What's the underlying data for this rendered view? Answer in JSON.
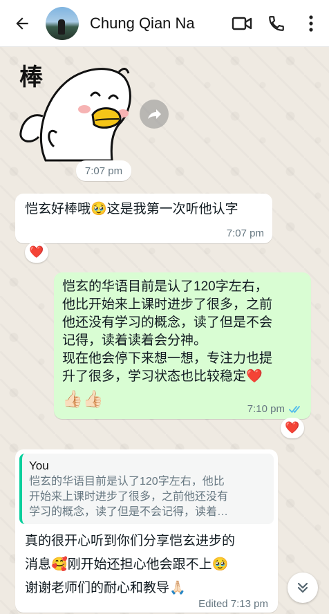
{
  "header": {
    "contact_name": "Chung Qian Na",
    "icons": [
      "back-arrow-icon",
      "video-call-icon",
      "voice-call-icon",
      "more-options-icon"
    ]
  },
  "sticker": {
    "text": "棒",
    "time": "7:07 pm"
  },
  "messages": [
    {
      "direction": "incoming",
      "text": "恺玄好棒哦🥹这是我第一次听他认字",
      "time": "7:07 pm",
      "reaction": "❤️"
    },
    {
      "direction": "outgoing",
      "lines": [
        "恺玄的华语目前是认了120字左右，",
        "他比开始来上课时进步了很多，之前",
        "他还没有学习的概念，读了但是不会",
        "记得，读着读着会分神。",
        "现在他会停下来想一想，专注力也提",
        "升了很多，学习状态也比较稳定❤️"
      ],
      "thumbs": "👍🏻👍🏻",
      "time": "7:10 pm",
      "status": "read",
      "reaction": "❤️"
    },
    {
      "direction": "incoming",
      "quote_author": "You",
      "quote_lines": [
        "恺玄的华语目前是认了120字左右，他比",
        "开始来上课时进步了很多，之前他还没有",
        "学习的概念，读了但是不会记得，读着…"
      ],
      "lines": [
        "真的很开心听到你们分享恺玄进步的",
        "消息🥰刚开始还担心他会跟不上🥹",
        "谢谢老师们的耐心和教导🙏🏻"
      ],
      "time": "Edited 7:13 pm"
    }
  ],
  "colors": {
    "outgoing_bubble": "#d9fdd3",
    "incoming_bubble": "#ffffff",
    "read_ticks": "#53bdeb",
    "quote_bar": "#06cf9c"
  }
}
